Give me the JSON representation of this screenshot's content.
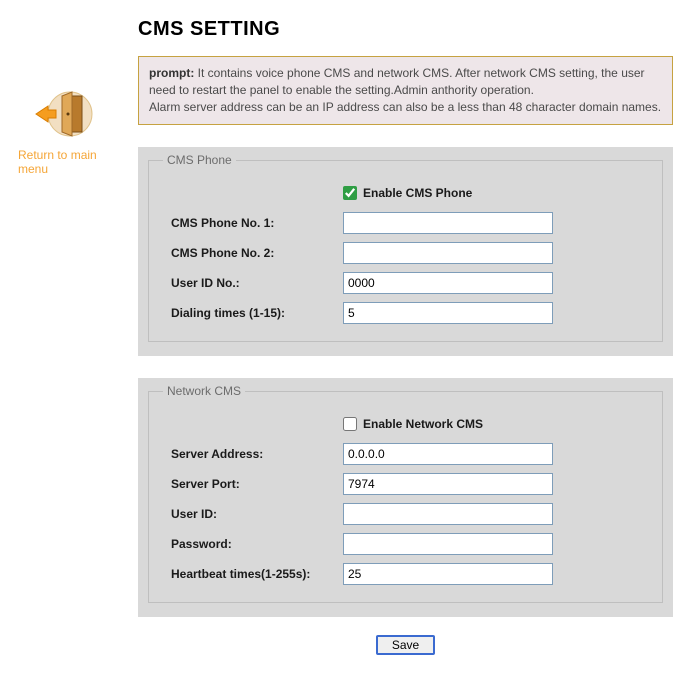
{
  "title": "CMS SETTING",
  "side_nav": {
    "label": "Return to main menu"
  },
  "prompt": {
    "label": "prompt:",
    "text": " It contains voice phone CMS and network CMS. After network CMS setting, the user need to restart the panel to enable the setting.Admin anthority operation.\nAlarm server address can be an IP address can also be a less than 48 character domain names."
  },
  "cms_phone": {
    "legend": "CMS Phone",
    "enable_label": "Enable CMS Phone",
    "enable_checked": true,
    "fields": {
      "phone1": {
        "label": "CMS Phone No. 1:",
        "value": ""
      },
      "phone2": {
        "label": "CMS Phone No. 2:",
        "value": ""
      },
      "user_id": {
        "label": "User ID No.:",
        "value": "0000"
      },
      "dialing": {
        "label": "Dialing times (1-15):",
        "value": "5"
      }
    }
  },
  "network_cms": {
    "legend": "Network CMS",
    "enable_label": "Enable Network CMS",
    "enable_checked": false,
    "fields": {
      "server_addr": {
        "label": "Server Address:",
        "value": "0.0.0.0"
      },
      "server_port": {
        "label": "Server Port:",
        "value": "7974"
      },
      "user_id": {
        "label": "User ID:",
        "value": ""
      },
      "password": {
        "label": "Password:",
        "value": ""
      },
      "heartbeat": {
        "label": "Heartbeat times(1-255s):",
        "value": "25"
      }
    }
  },
  "save_label": "Save"
}
